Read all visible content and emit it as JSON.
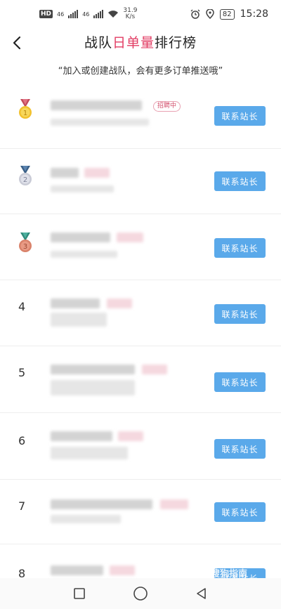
{
  "status_bar": {
    "hd": "HD",
    "sim1": "46",
    "sim2": "46",
    "speed_value": "31.9",
    "speed_unit": "K/s",
    "battery": "82",
    "time": "15:28"
  },
  "header": {
    "title_prefix": "战队",
    "title_highlight": "日单量",
    "title_suffix": "排行榜"
  },
  "slogan": "“加入或创建战队，会有更多订单推送哦”",
  "colors": {
    "accent_pink": "#e23d64",
    "button_blue": "#5aa9ea",
    "gold": "#f2c12e",
    "silver": "#c9cbd6",
    "bronze": "#d9826a"
  },
  "rows": [
    {
      "rank": "1",
      "medal": "gold",
      "badge": "招聘中",
      "button": "联系站长"
    },
    {
      "rank": "2",
      "medal": "silver",
      "button": "联系站长"
    },
    {
      "rank": "3",
      "medal": "bronze",
      "button": "联系站长"
    },
    {
      "rank": "4",
      "button": "联系站长"
    },
    {
      "rank": "5",
      "button": "联系站长"
    },
    {
      "rank": "6",
      "button": "联系站长"
    },
    {
      "rank": "7",
      "button": "联系站长"
    },
    {
      "rank": "8",
      "button": "联系站长"
    }
  ],
  "watermark": "搜狗指南",
  "nav": {
    "recent_icon": "square-icon",
    "home_icon": "circle-icon",
    "back_icon": "triangle-icon"
  }
}
